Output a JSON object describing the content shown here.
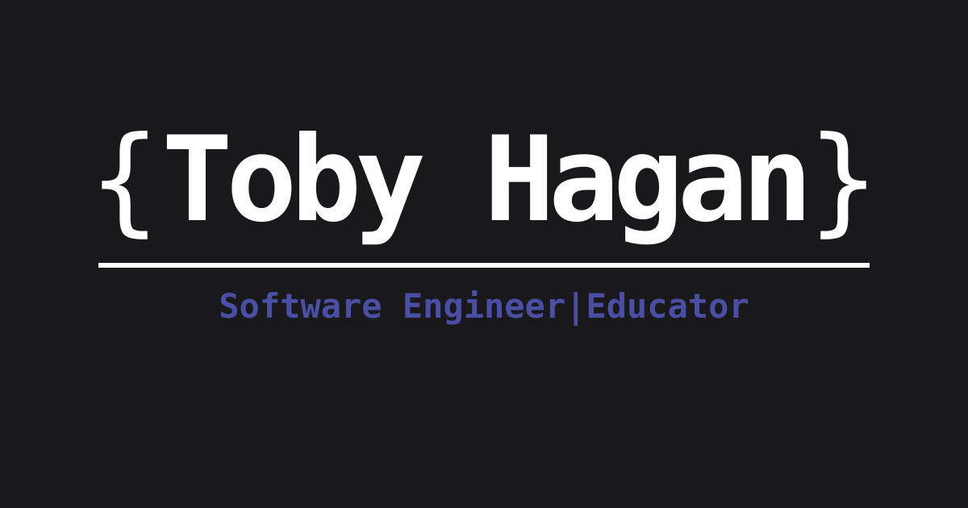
{
  "header": {
    "brace_open": "{",
    "name": "Toby Hagan",
    "brace_close": "}"
  },
  "tagline": {
    "role_one": "Software Engineer",
    "separator": "|",
    "role_two": "Educator"
  },
  "colors": {
    "background": "#19191b",
    "name": "#ffffff",
    "divider": "#ffffff",
    "tagline": "#4a4fa5"
  }
}
